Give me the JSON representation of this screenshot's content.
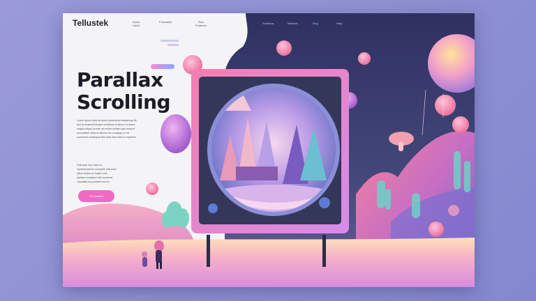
{
  "header": {
    "brand": "Tellustek",
    "nav_left": [
      {
        "label": "Home",
        "sub": "· stack ·"
      },
      {
        "label": "Formatted",
        "sub": "· ·"
      },
      {
        "label": "Plan",
        "sub": "Features"
      }
    ],
    "nav_right": [
      {
        "label": "Solutions",
        "active": false
      },
      {
        "label": "Network",
        "active": false
      },
      {
        "label": "Blog",
        "active": true
      },
      {
        "label": "Help",
        "active": false
      }
    ]
  },
  "hero": {
    "title_line1": "Parallax",
    "title_line2": "Scrolling",
    "para1": [
      "Lorem ipsum dolor sit amet consectetur adipiscing elit",
      "sed do eiusmod tempor incididunt ut labore et dolore",
      "magna aliqua ut enim ad minim veniam quis nostrud",
      "exercitation ullamco laboris nisi ut aliquip ex ea",
      "commodo consequat duis aute irure dolor in reprehen"
    ],
    "para2": [
      "Duis aute irure dolor in",
      "reprehenderit in voluptate velit esse",
      "cillum dolore eu fugiat nulla",
      "pariatur excepteur sint occaecat",
      "cupidatat non proident sunt in"
    ],
    "cta_label": "Get started"
  },
  "colors": {
    "accent": "#f06ac4",
    "night_sky": "#3a3e6b",
    "billboard_frame": "#ef7fb6",
    "page_bg": "#8a8ccf"
  }
}
